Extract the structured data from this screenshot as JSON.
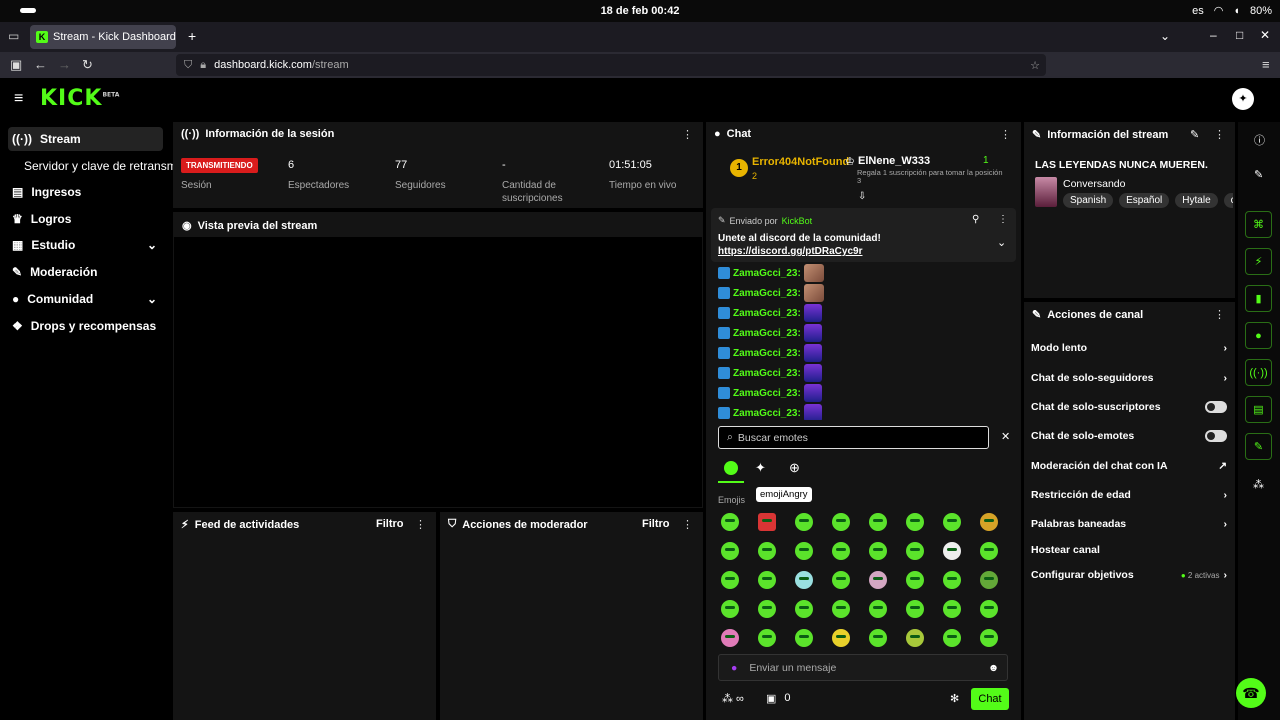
{
  "os": {
    "clock": "18 de feb  00:42",
    "lang": "es",
    "battery": "80%"
  },
  "browser": {
    "tab_title": "Stream - Kick Dashboard",
    "url_host": "dashboard.kick.com",
    "url_path": "/stream"
  },
  "app": {
    "logo": "KICK",
    "logo_badge": "BETA"
  },
  "sidebar": {
    "items": [
      {
        "label": "Stream"
      },
      {
        "label": "Servidor y clave de retransm"
      },
      {
        "label": "Ingresos"
      },
      {
        "label": "Logros"
      },
      {
        "label": "Estudio"
      },
      {
        "label": "Moderación"
      },
      {
        "label": "Comunidad"
      },
      {
        "label": "Drops y recompensas"
      }
    ]
  },
  "session": {
    "title": "Información de la sesión",
    "status": "TRANSMITIENDO",
    "status_label": "Sesión",
    "viewers": "6",
    "viewers_label": "Espectadores",
    "followers": "77",
    "followers_label": "Seguidores",
    "subs": "-",
    "subs_label": "Cantidad de suscripciones",
    "uptime": "01:51:05",
    "uptime_label": "Tiempo en vivo"
  },
  "preview": {
    "title": "Vista previa del stream"
  },
  "activity": {
    "title": "Feed de actividades",
    "filter": "Filtro"
  },
  "modactions": {
    "title": "Acciones de moderador",
    "filter": "Filtro"
  },
  "chat": {
    "title": "Chat",
    "leader1": {
      "name": "Error404NotFound",
      "count": "2",
      "rank": "1"
    },
    "leader2": {
      "name": "ElNene_W333",
      "count": "1",
      "note": "Regala 1 suscripción para tomar la posición 3"
    },
    "pinned": {
      "sent_by": "Enviado por",
      "bot": "KickBot",
      "text": "Unete al discord de la comunidad! ",
      "link": "https://discord.gg/ptDRaCyc9r"
    },
    "messages": [
      {
        "user": "ZamaGcci_23:"
      },
      {
        "user": "ZamaGcci_23:"
      },
      {
        "user": "ZamaGcci_23:"
      },
      {
        "user": "ZamaGcci_23:"
      },
      {
        "user": "ZamaGcci_23:"
      },
      {
        "user": "ZamaGcci_23:"
      },
      {
        "user": "ZamaGcci_23:"
      },
      {
        "user": "ZamaGcci_23:"
      }
    ],
    "emote_search_placeholder": "Buscar emotes",
    "emote_section": "Emojis",
    "tooltip": "emojiAngry",
    "input_placeholder": "Enviar un mensaje",
    "points": "0",
    "send_label": "Chat"
  },
  "stream_info": {
    "title": "Información del stream",
    "stream_title": "LAS LEYENDAS NUNCA MUEREN.",
    "category": "Conversando",
    "tags": [
      "Spanish",
      "Español",
      "Hytale",
      "ch"
    ]
  },
  "channel_actions": {
    "title": "Acciones de canal",
    "items": [
      {
        "label": "Modo lento"
      },
      {
        "label": "Chat de solo-seguidores"
      },
      {
        "label": "Chat de solo-suscriptores"
      },
      {
        "label": "Chat de solo-emotes"
      },
      {
        "label": "Moderación del chat con IA"
      },
      {
        "label": "Restricción de edad"
      },
      {
        "label": "Palabras baneadas"
      },
      {
        "label": "Hostear canal"
      },
      {
        "label": "Configurar objetivos"
      }
    ],
    "goals_active": "2 activas"
  },
  "colors": {
    "accent": "#53fc18",
    "live": "#d91c1c",
    "panel": "#141414"
  }
}
